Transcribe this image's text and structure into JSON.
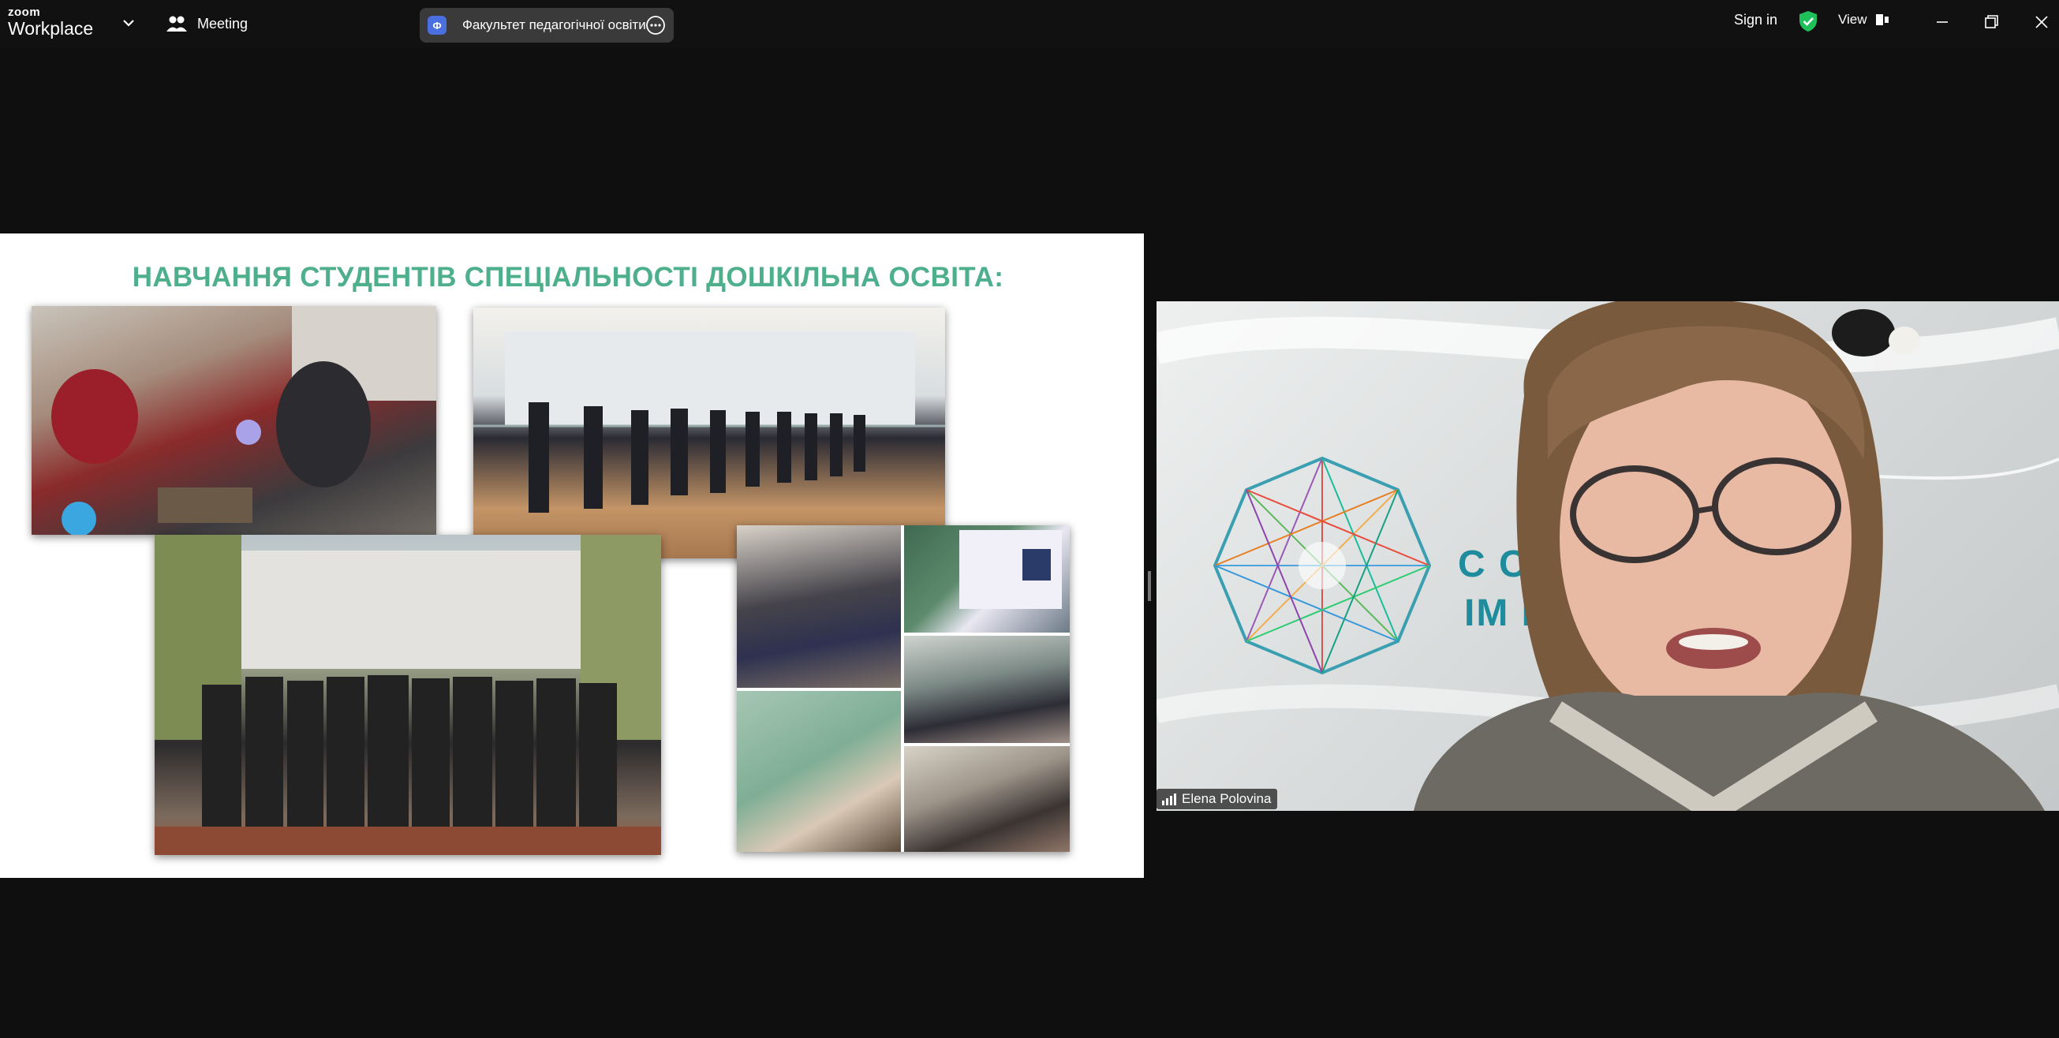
{
  "app": {
    "logo_top": "zoom",
    "logo_bottom": "Workplace"
  },
  "topbar": {
    "meeting_label": "Meeting",
    "share_pill_text": "Факультет педагогічної освіти -",
    "sign_in_label": "Sign in",
    "view_label": "View"
  },
  "slide": {
    "title": "НАВЧАННЯ СТУДЕНТІВ СПЕЦІАЛЬНОСТІ ДОШКІЛЬНА ОСВІТА:"
  },
  "video": {
    "participant_name": "Elena Polovina",
    "background_text_line1": "С           СИТЕТ",
    "background_text_line2": "ІМ           ЕНКА"
  },
  "colors": {
    "topbar_bg": "#111111",
    "canvas_bg": "#0f0f0f",
    "slide_title": "#4daf8c",
    "secure_shield": "#1fbf59",
    "share_icon": "#4a6fe0"
  },
  "icons": {
    "dropdown": "chevron-down-icon",
    "meeting": "people-icon",
    "more": "more-icon",
    "security": "shield-check-icon",
    "view": "view-icon",
    "minimize": "minimize-icon",
    "restore": "restore-icon",
    "close": "close-icon",
    "signal": "signal-icon"
  }
}
